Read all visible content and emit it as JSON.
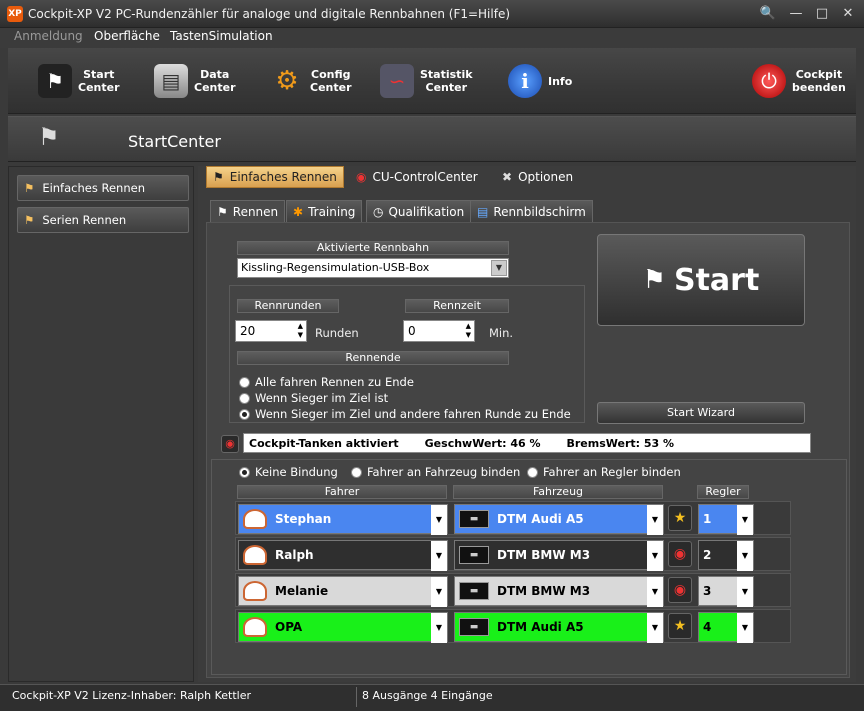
{
  "window": {
    "title": "Cockpit-XP V2 PC-Rundenzähler für analoge und digitale Rennbahnen (F1=Hilfe)",
    "app_icon": "XP"
  },
  "menu": [
    "Anmeldung",
    "Oberfläche",
    "TastenSimulation"
  ],
  "toolbar": {
    "buttons": [
      {
        "label": "Start\nCenter",
        "icon": "checkered-flag-icon"
      },
      {
        "label": "Data\nCenter",
        "icon": "server-icon"
      },
      {
        "label": "Config\nCenter",
        "icon": "gears-icon"
      },
      {
        "label": "Statistik\nCenter",
        "icon": "chart-icon"
      },
      {
        "label": "Info",
        "icon": "info-icon"
      },
      {
        "label": "Cockpit\nbeenden",
        "icon": "power-icon"
      }
    ]
  },
  "page_title": "StartCenter",
  "sidebar": {
    "items": [
      {
        "label": "Einfaches Rennen"
      },
      {
        "label": "Serien Rennen"
      }
    ]
  },
  "tabs_top": [
    {
      "label": "Einfaches Rennen",
      "active": true
    },
    {
      "label": "CU-ControlCenter"
    },
    {
      "label": "Optionen"
    }
  ],
  "tabs_sub": [
    {
      "label": "Rennen",
      "active": true
    },
    {
      "label": "Training"
    },
    {
      "label": "Qualifikation"
    },
    {
      "label": "Rennbildschirm"
    }
  ],
  "race": {
    "track_header": "Aktivierte Rennbahn",
    "track_value": "Kissling-Regensimulation-USB-Box",
    "laps_header": "Rennrunden",
    "laps_value": "20",
    "laps_unit": "Runden",
    "time_header": "Rennzeit",
    "time_value": "0",
    "time_unit": "Min.",
    "end_header": "Rennende",
    "end_options": [
      {
        "label": "Alle fahren Rennen zu Ende",
        "selected": false
      },
      {
        "label": "Wenn Sieger im Ziel ist",
        "selected": false
      },
      {
        "label": "Wenn Sieger im Ziel und andere fahren Runde zu Ende",
        "selected": true
      }
    ],
    "start_label": "Start",
    "wizard_label": "Start Wizard",
    "tank_info": "Cockpit-Tanken aktiviert",
    "speed_info": "GeschwWert: 46 %",
    "brake_info": "BremsWert: 53 %"
  },
  "binding": {
    "options": [
      {
        "label": "Keine Bindung",
        "selected": true
      },
      {
        "label": "Fahrer an Fahrzeug binden",
        "selected": false
      },
      {
        "label": "Fahrer an Regler binden",
        "selected": false
      }
    ],
    "col_driver": "Fahrer",
    "col_car": "Fahrzeug",
    "col_controller": "Regler"
  },
  "drivers": [
    {
      "name": "Stephan",
      "car": "DTM Audi A5",
      "controller": "1",
      "bg": "#4a86f0",
      "fg": "#ffffff",
      "icon": "star-icon"
    },
    {
      "name": "Ralph",
      "car": "DTM BMW M3",
      "controller": "2",
      "bg": "#2f2f2f",
      "fg": "#ffffff",
      "icon": "cu-icon"
    },
    {
      "name": "Melanie",
      "car": "DTM BMW M3",
      "controller": "3",
      "bg": "#d9d9d9",
      "fg": "#000000",
      "icon": "cu-icon"
    },
    {
      "name": "OPA",
      "car": "DTM Audi A5",
      "controller": "4",
      "bg": "#19f019",
      "fg": "#000000",
      "icon": "star-icon"
    }
  ],
  "status": {
    "license": "Cockpit-XP V2 Lizenz-Inhaber: Ralph Kettler",
    "io": "8 Ausgänge 4 Eingänge"
  }
}
